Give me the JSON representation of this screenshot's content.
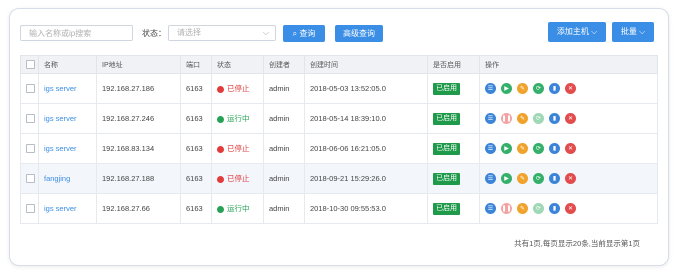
{
  "toolbar": {
    "search_placeholder": "输入名称或ip搜索",
    "status_label": "状态：",
    "status_placeholder": "请选择",
    "query_label": "查询",
    "advanced_label": "高级查询",
    "add_host_label": "添加主机",
    "batch_label": "批量"
  },
  "table": {
    "columns": [
      "名称",
      "IP地址",
      "端口",
      "状态",
      "创建者",
      "创建时间",
      "是否启用",
      "操作"
    ],
    "rows": [
      {
        "name": "igs server",
        "ip": "192.168.27.186",
        "port": "6163",
        "status": "已停止",
        "status_type": "stopped",
        "creator": "admin",
        "created": "2018-05-03 13:52:05.0",
        "enabled": "已启用",
        "highlight": false
      },
      {
        "name": "igs server",
        "ip": "192.168.27.246",
        "port": "6163",
        "status": "运行中",
        "status_type": "running",
        "creator": "admin",
        "created": "2018-05-14 18:39:10.0",
        "enabled": "已启用",
        "highlight": false
      },
      {
        "name": "igs server",
        "ip": "192.168.83.134",
        "port": "6163",
        "status": "已停止",
        "status_type": "stopped",
        "creator": "admin",
        "created": "2018-06-06 16:21:05.0",
        "enabled": "已启用",
        "highlight": false
      },
      {
        "name": "fangjing",
        "ip": "192.168.27.188",
        "port": "6163",
        "status": "已停止",
        "status_type": "stopped",
        "creator": "admin",
        "created": "2018-09-21 15:29:26.0",
        "enabled": "已启用",
        "highlight": true
      },
      {
        "name": "igs server",
        "ip": "192.168.27.66",
        "port": "6163",
        "status": "运行中",
        "status_type": "running",
        "creator": "admin",
        "created": "2018-10-30 09:55:53.0",
        "enabled": "已启用",
        "highlight": false
      }
    ]
  },
  "pager": {
    "summary": "共有1页,每页显示20条,当前显示第1页"
  },
  "colors": {
    "primary": "#3a8ee6",
    "stopped": "#e23b3b",
    "running": "#26a255",
    "enabled_badge": "#1f9a4b"
  },
  "icons": [
    "list-icon",
    "play-icon",
    "pause-icon",
    "edit-icon",
    "refresh-icon",
    "chart-icon",
    "delete-icon"
  ]
}
